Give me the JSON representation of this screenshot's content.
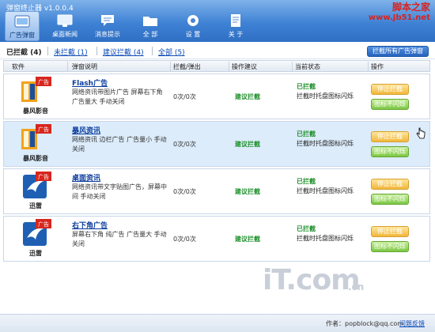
{
  "app": {
    "title": "弹窗终止器 v1.0.0.4"
  },
  "watermark_top": {
    "line1": "脚本之家",
    "line2": "www.Jb51.net"
  },
  "toolbar": {
    "buttons": [
      {
        "label": "广告弹窗",
        "icon": "ad-popup-icon"
      },
      {
        "label": "桌面新闻",
        "icon": "desktop-news-icon"
      },
      {
        "label": "消息提示",
        "icon": "message-icon"
      },
      {
        "label": "全 部",
        "icon": "folder-icon"
      },
      {
        "label": "设 置",
        "icon": "gear-icon"
      },
      {
        "label": "关 于",
        "icon": "document-icon"
      }
    ],
    "active_index": 0
  },
  "filters": {
    "blocked": "已拦截 (4)",
    "unblocked": "未拦截 (1)",
    "suggested": "建议拦截 (4)",
    "all": "全部 (5)",
    "block_all_button": "拦截所有广告弹窗"
  },
  "table": {
    "headers": [
      "软件",
      "弹窗说明",
      "拦截/弹出",
      "操作建议",
      "当前状态",
      "操作"
    ],
    "rows": [
      {
        "app": "暴风影音",
        "ad_title": "Flash广告",
        "desc": "网络资讯带图片广告 屏幕右下角 广告量大 手动关闭",
        "times": "0次/0次",
        "advice": "建议拦截",
        "status_head": "已拦截",
        "status_body": "拦截时托盘图标闪烁",
        "btn_stop": "停止拦截",
        "btn_flash": "图标不闪烁",
        "selected": false
      },
      {
        "app": "暴风影音",
        "ad_title": "暴风资讯",
        "desc": "网络资讯 边栏广告 广告量小 手动关闭",
        "times": "0次/0次",
        "advice": "建议拦截",
        "status_head": "已拦截",
        "status_body": "拦截时托盘图标闪烁",
        "btn_stop": "停止拦截",
        "btn_flash": "图标不闪烁",
        "selected": true
      },
      {
        "app": "迅雷",
        "ad_title": "桌面资讯",
        "desc": "网络资讯带文字贴图广告，屏幕中间 手动关闭",
        "times": "0次/0次",
        "advice": "建议拦截",
        "status_head": "已拦截",
        "status_body": "拦截时托盘图标闪烁",
        "btn_stop": "停止拦截",
        "btn_flash": "图标不闪烁",
        "selected": false
      },
      {
        "app": "迅雷",
        "ad_title": "右下角广告",
        "desc": "屏幕右下角 纯广告 广告量大 手动关闭",
        "times": "0次/0次",
        "advice": "建议拦截",
        "status_head": "已拦截",
        "status_body": "拦截时托盘图标闪烁",
        "btn_stop": "停止拦截",
        "btn_flash": "图标不闪烁",
        "selected": false
      }
    ]
  },
  "ad_badge": "广告",
  "brand": {
    "main": "iT.com",
    "small": ".cn"
  },
  "footer": {
    "author": "作者：popblock@qq.com",
    "feedback": "问题反馈"
  },
  "colors": {
    "toolbar": "#3f82d4",
    "selected_row": "#dcecfb",
    "green": "#1d8f2a",
    "link": "#0a49b8"
  }
}
